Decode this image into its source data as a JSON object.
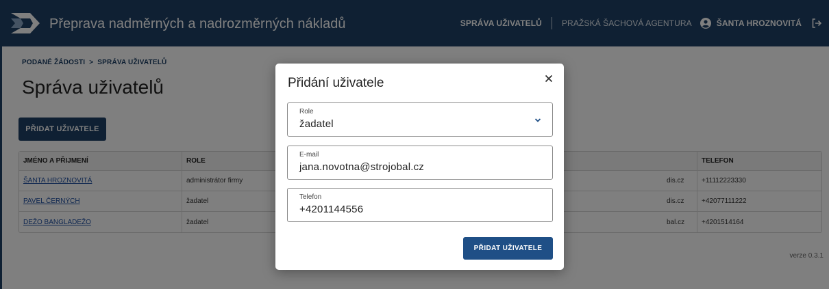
{
  "header": {
    "app_title": "Přeprava nadměrných a nadrozměrných nákladů",
    "nav_users": "SPRÁVA UŽIVATELŮ",
    "agency": "PRAŽSKÁ ŠACHOVÁ AGENTURA",
    "user_name": "ŠANTA HROZNOVITÁ"
  },
  "breadcrumb": {
    "item1": "PODANÉ ŽÁDOSTI",
    "separator": ">",
    "item2": "SPRÁVA UŽIVATELŮ"
  },
  "page": {
    "title": "Správa uživatelů",
    "add_button": "PŘIDAT UŽIVATELE",
    "version": "verze 0.3.1"
  },
  "table": {
    "headers": [
      "JMÉNO A PŘIJMENÍ",
      "ROLE",
      "",
      "TELEFON"
    ],
    "rows": [
      {
        "name": "ŠANTA HROZNOVITÁ",
        "role": "administrátor firmy",
        "email": "dis.cz",
        "phone": "+11112223330"
      },
      {
        "name": "PAVEL ČERNÝCH",
        "role": "žadatel",
        "email": "dis.cz",
        "phone": "+42077111222"
      },
      {
        "name": "DEŽO BANGLADEŽO",
        "role": "žadatel",
        "email": "bal.cz",
        "phone": "+4201514164"
      }
    ]
  },
  "modal": {
    "title": "Přidání uživatele",
    "role_label": "Role",
    "role_value": "žadatel",
    "email_label": "E-mail",
    "email_value": "jana.novotna@strojobal.cz",
    "phone_label": "Telefon",
    "phone_value": "+4201144556",
    "submit": "PŘIDAT UŽIVATELE"
  },
  "colors": {
    "header_bg": "#1f4166",
    "button_bg": "#1f4f86",
    "link": "#1f4fa0"
  }
}
